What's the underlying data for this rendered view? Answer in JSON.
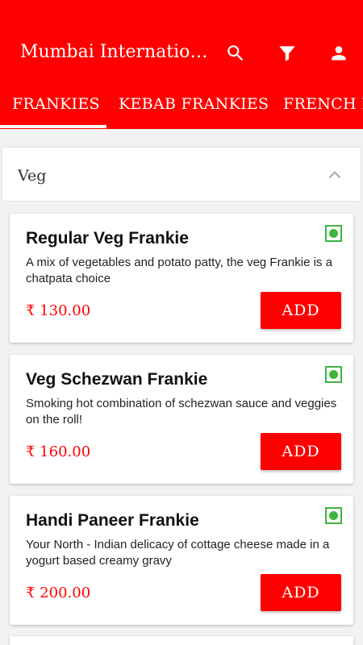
{
  "appbar": {
    "title": "Mumbai International...",
    "icons": [
      "search-icon",
      "filter-icon",
      "person-icon"
    ]
  },
  "tabs": [
    {
      "label": "FRANKIES",
      "selected": true
    },
    {
      "label": "KEBAB FRANKIES",
      "selected": false
    },
    {
      "label": "FRENCH F",
      "selected": false
    }
  ],
  "section": {
    "title": "Veg",
    "icon": "chevron-up-icon",
    "expanded": true
  },
  "items": [
    {
      "name": "Regular Veg Frankie",
      "description": "A mix of vegetables and potato patty, the veg Frankie is a chatpata choice",
      "price": "₹ 130.00",
      "add_label": "ADD",
      "veg": true
    },
    {
      "name": "Veg Schezwan Frankie",
      "description": "Smoking hot combination of schezwan sauce and veggies on the roll!",
      "price": "₹ 160.00",
      "add_label": "ADD",
      "veg": true
    },
    {
      "name": "Handi Paneer Frankie",
      "description": "Your North - Indian delicacy of cottage cheese made in a yogurt based creamy gravy",
      "price": "₹ 200.00",
      "add_label": "ADD",
      "veg": true
    }
  ],
  "colors": {
    "primary": "#ff0000",
    "veg_green": "#3fb53f",
    "background": "#f2f2f2"
  }
}
